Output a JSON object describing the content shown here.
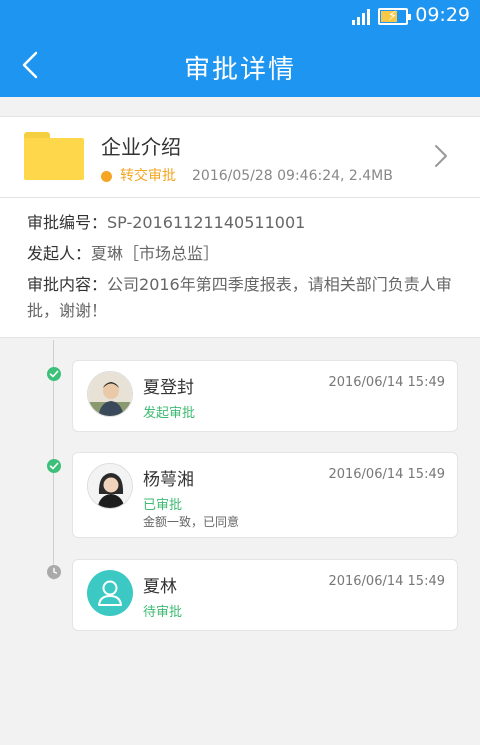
{
  "status_bar": {
    "time": "09:29",
    "icons": [
      "signal-icon",
      "battery-charging-icon"
    ]
  },
  "nav": {
    "title": "审批详情",
    "back_icon": "chevron-left-icon"
  },
  "colors": {
    "primary": "#1e95f0",
    "approved": "#3dc17a",
    "transfer": "#f5a623",
    "pending_node": "#aaaaaa",
    "avatar_teal": "#3cc9c4"
  },
  "document": {
    "name": "企业介绍",
    "status": "转交审批",
    "meta": "2016/05/28  09:46:24, 2.4MB",
    "icon": "folder-icon"
  },
  "info": {
    "number_label": "审批编号：",
    "number_value": "SP-20161121140511001",
    "initiator_label": "发起人：",
    "initiator_value": "夏琳［市场总监］",
    "content_label": "审批内容：",
    "content_value": "公司2016年第四季度报表，请相关部门负责人审批，谢谢！"
  },
  "timeline": [
    {
      "name": "夏登封",
      "time": "2016/06/14   15:49",
      "state": "发起审批",
      "comment": "",
      "node": "done"
    },
    {
      "name": "杨萼湘",
      "time": "2016/06/14   15:49",
      "state": "已审批",
      "comment": "金额一致，已同意",
      "node": "done"
    },
    {
      "name": "夏林",
      "time": "2016/06/14   15:49",
      "state": "待审批",
      "comment": "",
      "node": "pending"
    }
  ]
}
